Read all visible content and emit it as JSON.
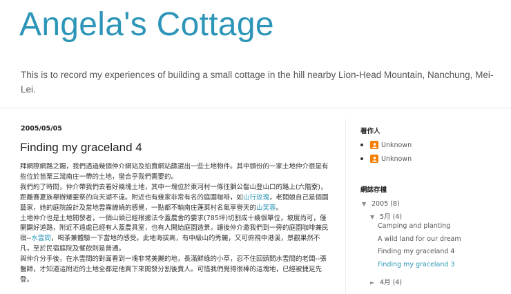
{
  "blog": {
    "title": "Angela's Cottage",
    "description": "This is to record my experiences of building a small cottage in the hill nearby Lion-Head Mountain, Nanchung, Mei-Lei."
  },
  "post": {
    "date": "2005/05/05",
    "title": "Finding my graceland 4",
    "p1": "拜網際網路之賜，我們透過幾個仲介網站及拍賣網站篩選出一些土地物件。其中頭份的一家土地仲介很是有些位於苗栗三灣南庄一帶的土地，蠻合乎我們需要的。",
    "p2a": "我們約了時間，仲介帶我們去看好幾塊土地，其中一塊位於東河村一條往獅公髻山登山口的路上(六階寮)，距離賽夏族舉辦矮靈祭的向天湖不遠。附近也有幾家非常有名的庭園咖啡，如",
    "p2_link1": "山行玫瑰",
    "p2b": "，老闆娘自己是個園藝家，她的庭院設計及當地雲霧繚繞的感覺，一點都不輸南庄蓬萊村名氣享譽天的",
    "p2_link2": "山芙蓉",
    "p2c": "。",
    "p3a": "土地仲介也是土地開發者，一個山頭已經根據法令蓋農舍的要求(785坪)切割成十幾個單位，坡度尚可，僅開闢好道路，附近不遠處已經有人蓋農具室，也有人開始庭園造景，讓後仲介邀我們到一旁的庭園咖啡兼民宿--",
    "p3_link": "水雲間",
    "p3b": "，喝茶兼體驗一下當地的感受。此地海拔高，有中級山的秀麗，又可俯視中港溪，景觀果然不凡，至於民宿庭院及餐飲則是普通。",
    "p4": "與仲介分手後，在水雲間的對面看到一塊非常美麗的地，長滿鮮綠的小草，忍不住回頭問水雲間的老闆--張醫師，才知道這附近的土地全都是他買下來開發分割後賣人。可惜我們覺得很棒的這塊地，已經被捷足先登。"
  },
  "sidebar": {
    "authors_title": "著作人",
    "authors": [
      "Unknown",
      "Unknown"
    ],
    "archive_title": "網誌存檔",
    "archive": {
      "toggle_open": "▼",
      "toggle_closed": "►",
      "year": "2005",
      "year_count": "(8)",
      "month1": "5月",
      "month1_count": "(4)",
      "posts": [
        "Camping and planting",
        "A wild land for our dream",
        "Finding my graceland 4",
        "Finding my graceland 3"
      ],
      "month2": "4月",
      "month2_count": "(4)"
    }
  },
  "colors": {
    "accent": "#2d96b8",
    "blogger_orange": "#f57d00"
  }
}
